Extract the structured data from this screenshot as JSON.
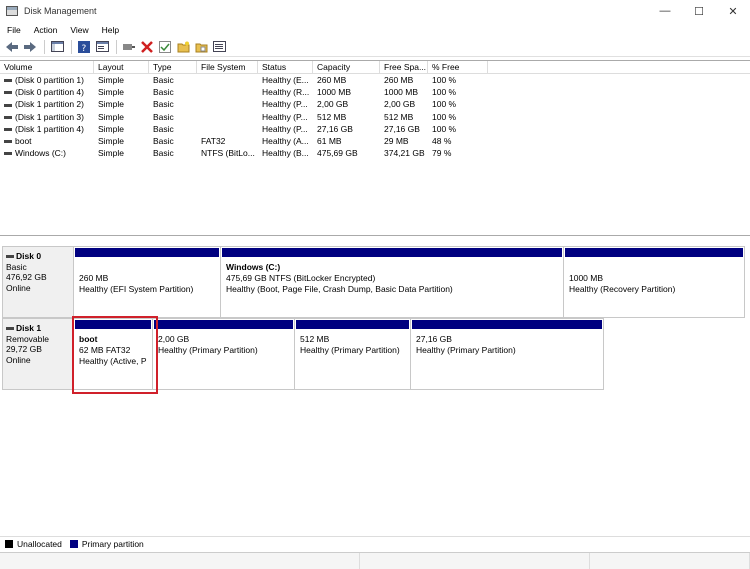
{
  "window": {
    "title": "Disk Management",
    "minimize": "—",
    "maximize": "☐",
    "close": "✕"
  },
  "menu": [
    "File",
    "Action",
    "View",
    "Help"
  ],
  "table": {
    "headers": [
      "Volume",
      "Layout",
      "Type",
      "File System",
      "Status",
      "Capacity",
      "Free Spa...",
      "% Free"
    ],
    "rows": [
      [
        "(Disk 0 partition 1)",
        "Simple",
        "Basic",
        "",
        "Healthy (E...",
        "260 MB",
        "260 MB",
        "100 %"
      ],
      [
        "(Disk 0 partition 4)",
        "Simple",
        "Basic",
        "",
        "Healthy (R...",
        "1000 MB",
        "1000 MB",
        "100 %"
      ],
      [
        "(Disk 1 partition 2)",
        "Simple",
        "Basic",
        "",
        "Healthy (P...",
        "2,00 GB",
        "2,00 GB",
        "100 %"
      ],
      [
        "(Disk 1 partition 3)",
        "Simple",
        "Basic",
        "",
        "Healthy (P...",
        "512 MB",
        "512 MB",
        "100 %"
      ],
      [
        "(Disk 1 partition 4)",
        "Simple",
        "Basic",
        "",
        "Healthy (P...",
        "27,16 GB",
        "27,16 GB",
        "100 %"
      ],
      [
        "boot",
        "Simple",
        "Basic",
        "FAT32",
        "Healthy (A...",
        "61 MB",
        "29 MB",
        "48 %"
      ],
      [
        "Windows (C:)",
        "Simple",
        "Basic",
        "NTFS (BitLo...",
        "Healthy (B...",
        "475,69 GB",
        "374,21 GB",
        "79 %"
      ]
    ]
  },
  "disk0": {
    "name": "Disk 0",
    "type": "Basic",
    "size": "476,92 GB",
    "status": "Online",
    "partitions": [
      {
        "name": "",
        "line1": "260 MB",
        "line2": "Healthy (EFI System Partition)"
      },
      {
        "name": "Windows  (C:)",
        "line1": "475,69 GB NTFS (BitLocker Encrypted)",
        "line2": "Healthy (Boot, Page File, Crash Dump, Basic Data Partition)"
      },
      {
        "name": "",
        "line1": "1000 MB",
        "line2": "Healthy (Recovery Partition)"
      }
    ]
  },
  "disk1": {
    "name": "Disk 1",
    "type": "Removable",
    "size": "29,72 GB",
    "status": "Online",
    "partitions": [
      {
        "name": "boot",
        "line1": "62 MB FAT32",
        "line2": "Healthy (Active, P"
      },
      {
        "name": "",
        "line1": "2,00 GB",
        "line2": "Healthy (Primary Partition)"
      },
      {
        "name": "",
        "line1": "512 MB",
        "line2": "Healthy (Primary Partition)"
      },
      {
        "name": "",
        "line1": "27,16 GB",
        "line2": "Healthy (Primary Partition)"
      }
    ]
  },
  "legend": [
    {
      "label": "Unallocated",
      "color": "#000000"
    },
    {
      "label": "Primary partition",
      "color": "#000080"
    }
  ],
  "colors": {
    "partition_bar": "#000080",
    "highlight": "#d0202a"
  }
}
